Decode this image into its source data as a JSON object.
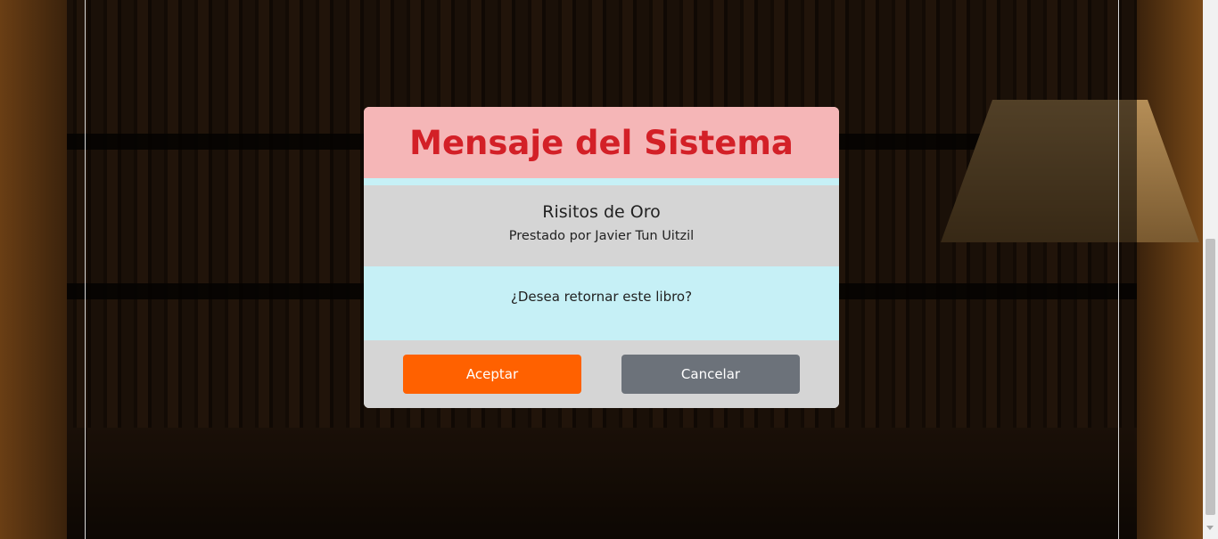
{
  "modal": {
    "title": "Mensaje del Sistema",
    "book_title": "Risitos de Oro",
    "lender": "Prestado por Javier Tun Uitzil",
    "question": "¿Desea retornar este libro?",
    "accept_label": "Aceptar",
    "cancel_label": "Cancelar"
  },
  "colors": {
    "header_bg": "#f5b6b7",
    "title": "#d32027",
    "body_bg": "#c6f0f6",
    "accept": "#ff6100",
    "cancel": "#6c727a"
  }
}
